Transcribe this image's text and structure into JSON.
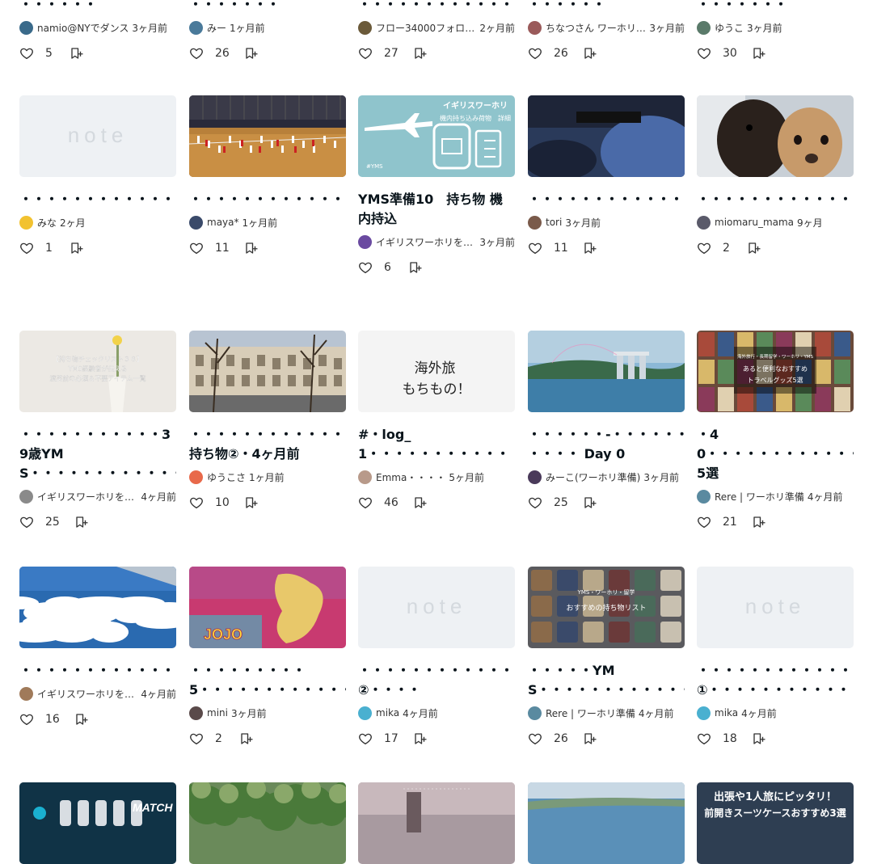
{
  "rows": [
    [
      {
        "title": "・・・・・・",
        "author": "namio@NYでダンス",
        "time": "3ヶ月前",
        "likes": "5",
        "thumb": "none",
        "avatar": "#3a6a8a"
      },
      {
        "title": "・・・・・・・",
        "author": "みー",
        "time": "1ヶ月前",
        "likes": "26",
        "thumb": "none",
        "avatar": "#4a7a9a"
      },
      {
        "title": "・・・・・・・・・・・・・・・・",
        "author": "フロー34000フォロワーと一緒に旅行する",
        "time": "2ヶ月前",
        "likes": "27",
        "thumb": "none",
        "avatar": "#6b5a3a"
      },
      {
        "title": "・・・・・・",
        "author": "ちなつさん ワーホリ準備2年目",
        "time": "3ヶ月前",
        "likes": "26",
        "thumb": "none",
        "avatar": "#9a5a5a"
      },
      {
        "title": "・・・・・・・",
        "author": "ゆうこ",
        "time": "3ヶ月前",
        "likes": "30",
        "thumb": "none",
        "avatar": "#5a7a6a"
      }
    ],
    [
      {
        "title": "・・・・・・・・・・・・・・・・・・・・・・・・・・・・・",
        "author": "みな",
        "time": "2ヶ月",
        "likes": "1",
        "thumb": "note",
        "avatar": "#f2c230"
      },
      {
        "title": "・・・・・・・・・・・・・・・・・・・・・・・・・・・・・・・・・・・・・・・・・・・・・・・・・・・・・・",
        "author": "maya*",
        "time": "1ヶ月前",
        "likes": "11",
        "thumb": "gym",
        "avatar": "#3a4a6a"
      },
      {
        "title": "YMS準備10　持ち物 機内持込",
        "author": "イギリスワーホリをしているよ",
        "time": "3ヶ月前",
        "likes": "6",
        "thumb": "plane",
        "avatar": "#6a4aa0"
      },
      {
        "title": "・・・・・・・・・・・・・・",
        "author": "tori",
        "time": "3ヶ月前",
        "likes": "11",
        "thumb": "bag",
        "avatar": "#7a5a4a"
      },
      {
        "title": "・・・・・・・・・・・・",
        "author": "miomaru_mama",
        "time": "9ヶ月",
        "likes": "2",
        "thumb": "dog",
        "avatar": "#5a5a6a"
      }
    ],
    [
      {
        "title": "・・・・・・・・・・・39歳YMS・・・・・・・・・・・・・・・・・・・・・・・",
        "author": "イギリスワーホリをしている人のYMS",
        "time": "4ヶ月前",
        "likes": "25",
        "thumb": "vase",
        "avatar": "#8a8a8a"
      },
      {
        "title": "・・・・・・・・・・・・・・・・・・・・・・持ち物②・4ヶ月前",
        "author": "ゆうこさ",
        "time": "1ヶ月前",
        "likes": "10",
        "thumb": "paris",
        "avatar": "#e8694a"
      },
      {
        "title": "#・log_1・・・・・・・・・・・",
        "author": "Emma・・・・",
        "time": "5ヶ月前",
        "likes": "46",
        "thumb": "handwrite",
        "avatar": "#b89a8a"
      },
      {
        "title": "・・・・・・-・・・・・・ ・・・・ Day 0",
        "author": "みーこ(ワーホリ準備)",
        "time": "3ヶ月前",
        "likes": "25",
        "thumb": "singapore",
        "avatar": "#4a3a5a"
      },
      {
        "title": "・40・・・・・・・・・・・・・・・・・・・・・・・・・・・・・・・・・5選",
        "author": "Rere | ワーホリ準備",
        "time": "4ヶ月前",
        "likes": "21",
        "thumb": "travelgoods",
        "avatar": "#5a8aa0"
      }
    ],
    [
      {
        "title": "・・・・・・・・・・・・・・・・・",
        "author": "イギリスワーホリをしている人の",
        "time": "4ヶ月前",
        "likes": "16",
        "thumb": "sky",
        "avatar": "#a07a5a"
      },
      {
        "title": "・・・・・・・・・5・・・・・・・・・・・・・・・・・　・・・",
        "author": "mini",
        "time": "3ヶ月前",
        "likes": "2",
        "thumb": "pinkmap",
        "avatar": "#5a4a4a"
      },
      {
        "title": "・・・・・・・・・・・・・・②・・・・",
        "author": "mika",
        "time": "4ヶ月前",
        "likes": "17",
        "thumb": "note",
        "avatar": "#4ab0d0"
      },
      {
        "title": "・・・・・YMS・・・・・・・・・・・・・・・・・・・・・・",
        "author": "Rere | ワーホリ準備",
        "time": "4ヶ月前",
        "likes": "26",
        "thumb": "items",
        "avatar": "#5a8aa0"
      },
      {
        "title": "・・・・・・・・・・・・・①・・・・・・・・・・・",
        "author": "mika",
        "time": "4ヶ月前",
        "likes": "18",
        "thumb": "note",
        "avatar": "#4ab0d0"
      }
    ],
    [
      {
        "thumb": "esports"
      },
      {
        "thumb": "trees"
      },
      {
        "thumb": "train"
      },
      {
        "thumb": "coast"
      },
      {
        "thumb": "suitcase",
        "thumb_text": [
          "出張や1人旅にピッタリ！",
          "前開きスーツケースおすすめ3選"
        ]
      }
    ]
  ],
  "thumb_texts": {
    "note_logo": "note",
    "plane_title": "イギリスワーホリ",
    "plane_sub": "機内持ち込み荷物　詳細",
    "plane_tag": "#YMS",
    "vase_l1": "【持ち物チェックリスト３８】",
    "vase_l2": "YMS経験者が伝える",
    "vase_l3": "渡英前の必須＆不要アイテム一覧",
    "hand_l1": "海外旅",
    "hand_l2": "もちもの！",
    "tg_l1": "海外旅行・長期留学・ワーホリ・YMS",
    "tg_l2": "あると便利なおすすめ",
    "tg_l3": "トラベルグッズ5選",
    "items_l1": "YMS・ワーホリ・留学",
    "items_l2": "おすすめの持ち物リスト",
    "esports": "MATCH W",
    "jojo": "JOJO"
  }
}
